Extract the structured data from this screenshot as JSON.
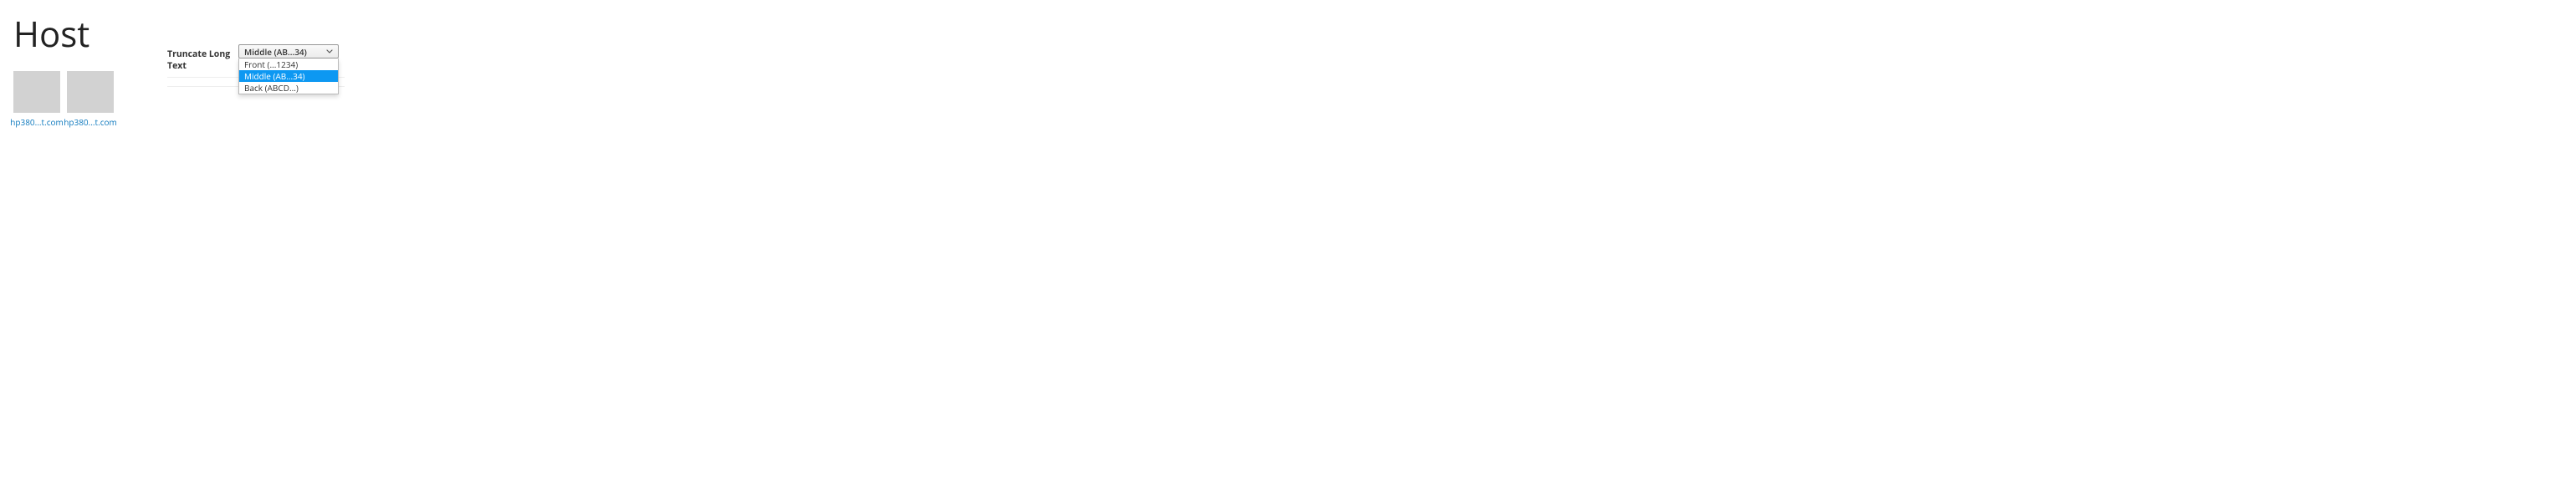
{
  "title": "Host",
  "hosts": [
    {
      "label": "hp380...t.com"
    },
    {
      "label": "hp380...t.com"
    }
  ],
  "setting": {
    "label": "Truncate Long Text",
    "selected": "Middle (AB...34)",
    "options": [
      {
        "label": "Front (...1234)",
        "selected": false
      },
      {
        "label": "Middle (AB...34)",
        "selected": true
      },
      {
        "label": "Back (ABCD...)",
        "selected": false
      }
    ]
  }
}
